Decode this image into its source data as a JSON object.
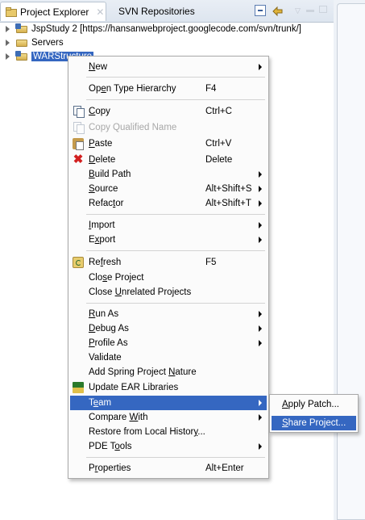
{
  "tabs": [
    {
      "label": "Project Explorer",
      "icon": "project-explorer-icon",
      "active": true
    },
    {
      "label": "SVN Repositories",
      "active": false
    }
  ],
  "tree": [
    {
      "label": "JspStudy 2 [https://hansanwebproject.googlecode.com/svn/trunk/]",
      "icon": "java-project-icon"
    },
    {
      "label": "Servers",
      "icon": "folder-icon"
    },
    {
      "label": "WARStructure",
      "icon": "java-project-icon",
      "selected": true
    }
  ],
  "context_menu": {
    "items": [
      {
        "pre": "",
        "u": "N",
        "post": "ew",
        "submenu": true
      },
      {
        "pre": "Op",
        "u": "e",
        "post": "n Type Hierarchy",
        "accel": "F4"
      },
      {
        "pre": "",
        "u": "C",
        "post": "opy",
        "accel": "Ctrl+C",
        "icon": "copy-icon"
      },
      {
        "pre": "Copy Qualified Name",
        "u": "",
        "post": "",
        "disabled": true,
        "icon": "copy-qualified-name-icon"
      },
      {
        "pre": "",
        "u": "P",
        "post": "aste",
        "accel": "Ctrl+V",
        "icon": "paste-icon"
      },
      {
        "pre": "",
        "u": "D",
        "post": "elete",
        "accel": "Delete",
        "icon": "delete-icon"
      },
      {
        "pre": "",
        "u": "B",
        "post": "uild Path",
        "submenu": true
      },
      {
        "pre": "",
        "u": "S",
        "post": "ource",
        "accel": "Alt+Shift+S",
        "submenu": true
      },
      {
        "pre": "Refac",
        "u": "t",
        "post": "or",
        "accel": "Alt+Shift+T",
        "submenu": true
      },
      {
        "pre": "",
        "u": "I",
        "post": "mport",
        "submenu": true
      },
      {
        "pre": "E",
        "u": "x",
        "post": "port",
        "submenu": true
      },
      {
        "pre": "Re",
        "u": "f",
        "post": "resh",
        "accel": "F5",
        "icon": "refresh-icon"
      },
      {
        "pre": "Clo",
        "u": "s",
        "post": "e Project"
      },
      {
        "pre": "Close ",
        "u": "U",
        "post": "nrelated Projects"
      },
      {
        "pre": "",
        "u": "R",
        "post": "un As",
        "submenu": true
      },
      {
        "pre": "",
        "u": "D",
        "post": "ebug As",
        "submenu": true
      },
      {
        "pre": "",
        "u": "P",
        "post": "rofile As",
        "submenu": true
      },
      {
        "pre": "Validate",
        "u": "",
        "post": ""
      },
      {
        "pre": "Add Spring Project ",
        "u": "N",
        "post": "ature"
      },
      {
        "pre": "Update EAR Libraries",
        "u": "",
        "post": "",
        "icon": "ear-libraries-icon"
      },
      {
        "pre": "T",
        "u": "e",
        "post": "am",
        "submenu": true,
        "highlighted": true
      },
      {
        "pre": "Compare ",
        "u": "W",
        "post": "ith",
        "submenu": true
      },
      {
        "pre": "Restore from Local Histor",
        "u": "y",
        "post": "..."
      },
      {
        "pre": "PDE T",
        "u": "o",
        "post": "ols",
        "submenu": true
      },
      {
        "pre": "P",
        "u": "r",
        "post": "operties",
        "accel": "Alt+Enter"
      }
    ]
  },
  "team_submenu": [
    {
      "pre": "",
      "u": "A",
      "post": "pply Patch..."
    },
    {
      "pre": "",
      "u": "S",
      "post": "hare Project...",
      "highlighted": true
    }
  ],
  "colors": {
    "selection": "#3567c1"
  }
}
